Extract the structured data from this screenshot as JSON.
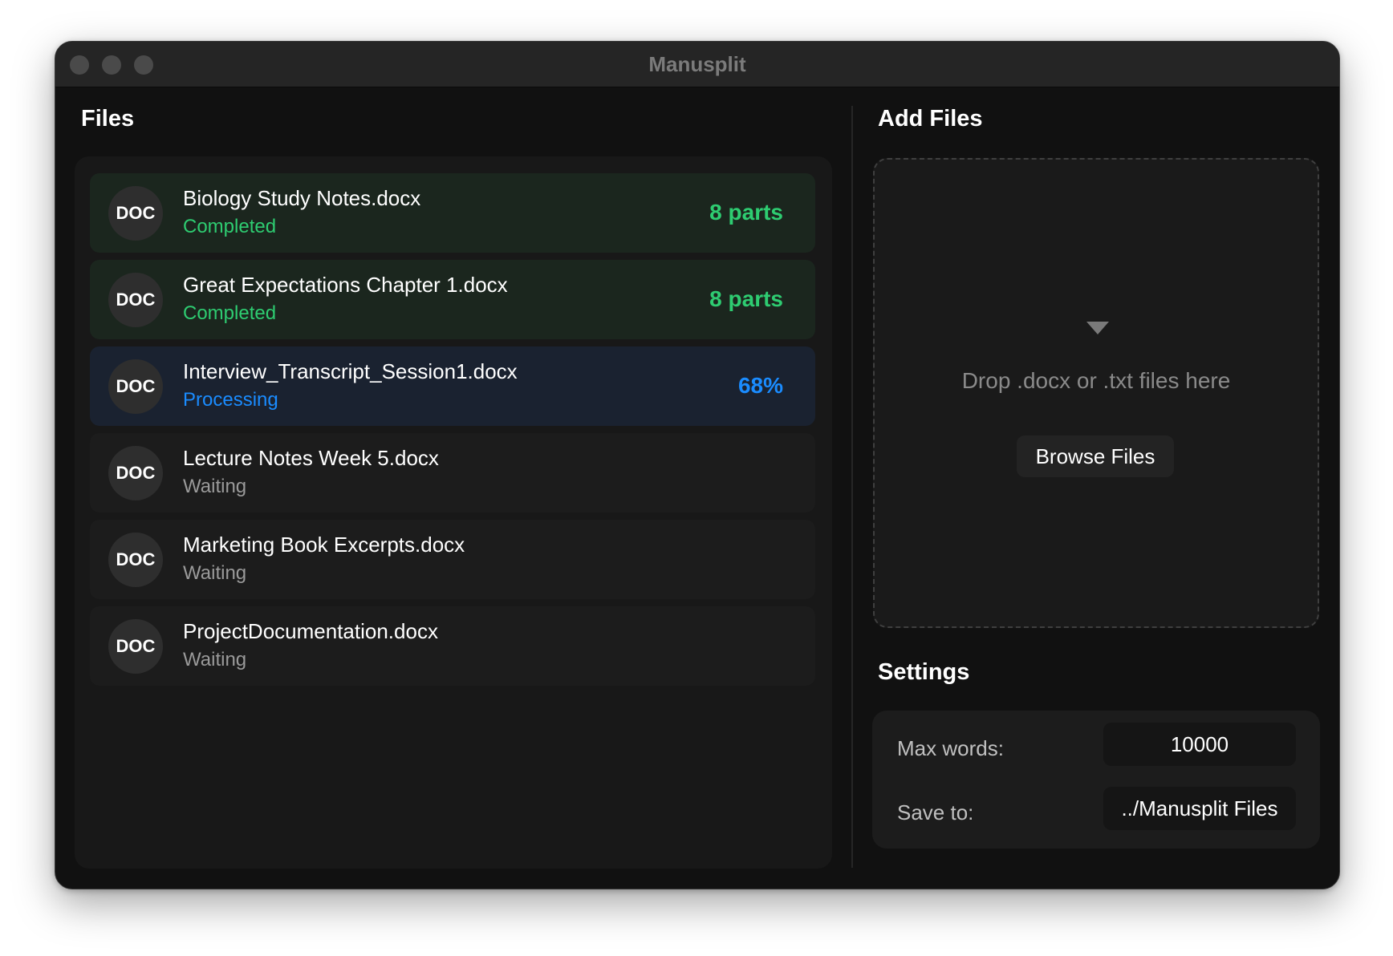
{
  "window": {
    "title": "Manusplit"
  },
  "files": {
    "title": "Files",
    "items": [
      {
        "icon_label": "DOC",
        "name": "Biology Study Notes.docx",
        "status": "Completed",
        "result": "8 parts"
      },
      {
        "icon_label": "DOC",
        "name": "Great Expectations Chapter 1.docx",
        "status": "Completed",
        "result": "8 parts"
      },
      {
        "icon_label": "DOC",
        "name": "Interview_Transcript_Session1.docx",
        "status": "Processing",
        "result": "68%"
      },
      {
        "icon_label": "DOC",
        "name": "Lecture Notes Week 5.docx",
        "status": "Waiting",
        "result": ""
      },
      {
        "icon_label": "DOC",
        "name": "Marketing Book Excerpts.docx",
        "status": "Waiting",
        "result": ""
      },
      {
        "icon_label": "DOC",
        "name": "ProjectDocumentation.docx",
        "status": "Waiting",
        "result": ""
      }
    ]
  },
  "add_files": {
    "title": "Add Files",
    "drop_icon": "down-triangle-icon",
    "drop_text": "Drop .docx or .txt files here",
    "browse_label": "Browse Files"
  },
  "settings": {
    "title": "Settings",
    "max_words_label": "Max words:",
    "max_words_value": "10000",
    "save_to_label": "Save to:",
    "save_to_value": "../Manusplit Files"
  },
  "colors": {
    "completed": "#2ecc71",
    "processing": "#1a8cff",
    "waiting": "#9a9a9a",
    "background": "#111111"
  }
}
